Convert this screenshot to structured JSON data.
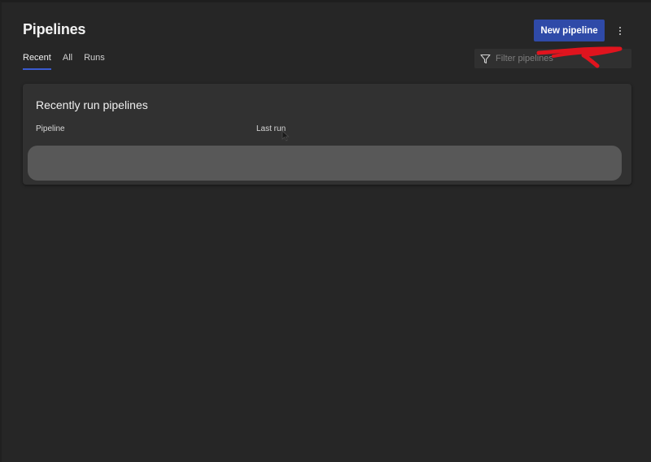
{
  "header": {
    "title": "Pipelines",
    "new_button_label": "New pipeline",
    "more_icon": "more-vertical-icon"
  },
  "tabs": [
    {
      "label": "Recent",
      "active": true
    },
    {
      "label": "All",
      "active": false
    },
    {
      "label": "Runs",
      "active": false
    }
  ],
  "filter": {
    "placeholder": "Filter pipelines",
    "icon": "filter-icon",
    "value": ""
  },
  "card": {
    "title": "Recently run pipelines",
    "columns": [
      "Pipeline",
      "Last run"
    ]
  },
  "colors": {
    "background": "#262626",
    "card": "#313131",
    "accent": "#2f4aa8",
    "tab_underline": "#3a5bd0",
    "annotation": "#e0141e"
  }
}
